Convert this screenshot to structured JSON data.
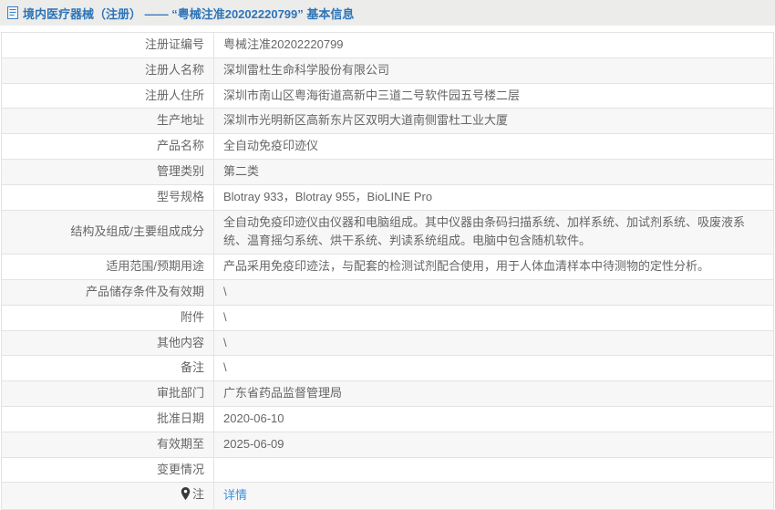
{
  "header": {
    "icon": "document-icon",
    "title": "境内医疗器械（注册） —— “粤械注准20202220799” 基本信息"
  },
  "table": {
    "rows": [
      {
        "label": "注册证编号",
        "value": "粤械注准20202220799"
      },
      {
        "label": "注册人名称",
        "value": "深圳雷杜生命科学股份有限公司"
      },
      {
        "label": "注册人住所",
        "value": "深圳市南山区粤海街道高新中三道二号软件园五号楼二层"
      },
      {
        "label": "生产地址",
        "value": "深圳市光明新区高新东片区双明大道南侧雷杜工业大厦"
      },
      {
        "label": "产品名称",
        "value": "全自动免疫印迹仪"
      },
      {
        "label": "管理类别",
        "value": "第二类"
      },
      {
        "label": "型号规格",
        "value": "Blotray 933，Blotray 955，BioLINE Pro"
      },
      {
        "label": "结构及组成/主要组成成分",
        "value": "全自动免疫印迹仪由仪器和电脑组成。其中仪器由条码扫描系统、加样系统、加试剂系统、吸废液系统、温育摇匀系统、烘干系统、判读系统组成。电脑中包含随机软件。"
      },
      {
        "label": "适用范围/预期用途",
        "value": "产品采用免疫印迹法，与配套的检测试剂配合使用，用于人体血清样本中待测物的定性分析。"
      },
      {
        "label": "产品储存条件及有效期",
        "value": "\\"
      },
      {
        "label": "附件",
        "value": "\\"
      },
      {
        "label": "其他内容",
        "value": "\\"
      },
      {
        "label": "备注",
        "value": "\\"
      },
      {
        "label": "审批部门",
        "value": "广东省药品监督管理局"
      },
      {
        "label": "批准日期",
        "value": "2020-06-10"
      },
      {
        "label": "有效期至",
        "value": "2025-06-09"
      },
      {
        "label": "变更情况",
        "value": ""
      },
      {
        "label": "注",
        "value": "详情",
        "icon": "pin-icon",
        "is_link": true
      }
    ]
  },
  "colors": {
    "title_blue": "#2d74b9",
    "link_blue": "#3e8ede",
    "header_bg": "#ececea",
    "row_stripe": "#f7f7f7",
    "border": "#e3e3e3",
    "text": "#666666"
  }
}
